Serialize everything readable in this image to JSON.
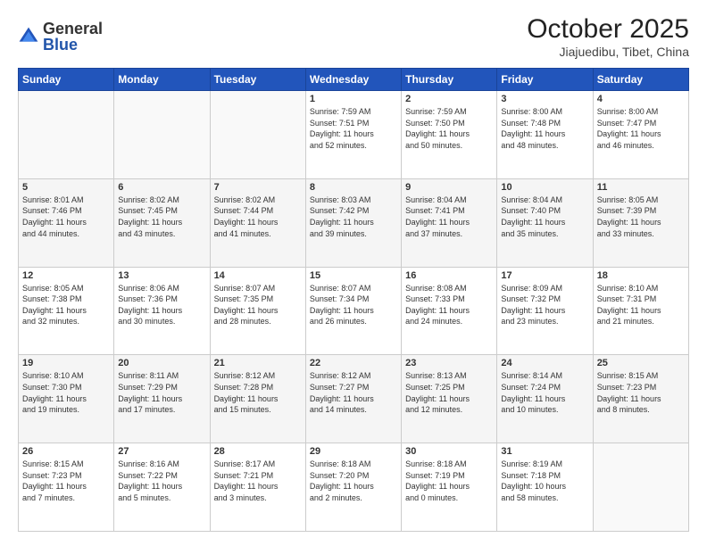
{
  "header": {
    "logo_general": "General",
    "logo_blue": "Blue",
    "month": "October 2025",
    "location": "Jiajuedibu, Tibet, China"
  },
  "days_of_week": [
    "Sunday",
    "Monday",
    "Tuesday",
    "Wednesday",
    "Thursday",
    "Friday",
    "Saturday"
  ],
  "weeks": [
    [
      {
        "day": "",
        "info": ""
      },
      {
        "day": "",
        "info": ""
      },
      {
        "day": "",
        "info": ""
      },
      {
        "day": "1",
        "info": "Sunrise: 7:59 AM\nSunset: 7:51 PM\nDaylight: 11 hours\nand 52 minutes."
      },
      {
        "day": "2",
        "info": "Sunrise: 7:59 AM\nSunset: 7:50 PM\nDaylight: 11 hours\nand 50 minutes."
      },
      {
        "day": "3",
        "info": "Sunrise: 8:00 AM\nSunset: 7:48 PM\nDaylight: 11 hours\nand 48 minutes."
      },
      {
        "day": "4",
        "info": "Sunrise: 8:00 AM\nSunset: 7:47 PM\nDaylight: 11 hours\nand 46 minutes."
      }
    ],
    [
      {
        "day": "5",
        "info": "Sunrise: 8:01 AM\nSunset: 7:46 PM\nDaylight: 11 hours\nand 44 minutes."
      },
      {
        "day": "6",
        "info": "Sunrise: 8:02 AM\nSunset: 7:45 PM\nDaylight: 11 hours\nand 43 minutes."
      },
      {
        "day": "7",
        "info": "Sunrise: 8:02 AM\nSunset: 7:44 PM\nDaylight: 11 hours\nand 41 minutes."
      },
      {
        "day": "8",
        "info": "Sunrise: 8:03 AM\nSunset: 7:42 PM\nDaylight: 11 hours\nand 39 minutes."
      },
      {
        "day": "9",
        "info": "Sunrise: 8:04 AM\nSunset: 7:41 PM\nDaylight: 11 hours\nand 37 minutes."
      },
      {
        "day": "10",
        "info": "Sunrise: 8:04 AM\nSunset: 7:40 PM\nDaylight: 11 hours\nand 35 minutes."
      },
      {
        "day": "11",
        "info": "Sunrise: 8:05 AM\nSunset: 7:39 PM\nDaylight: 11 hours\nand 33 minutes."
      }
    ],
    [
      {
        "day": "12",
        "info": "Sunrise: 8:05 AM\nSunset: 7:38 PM\nDaylight: 11 hours\nand 32 minutes."
      },
      {
        "day": "13",
        "info": "Sunrise: 8:06 AM\nSunset: 7:36 PM\nDaylight: 11 hours\nand 30 minutes."
      },
      {
        "day": "14",
        "info": "Sunrise: 8:07 AM\nSunset: 7:35 PM\nDaylight: 11 hours\nand 28 minutes."
      },
      {
        "day": "15",
        "info": "Sunrise: 8:07 AM\nSunset: 7:34 PM\nDaylight: 11 hours\nand 26 minutes."
      },
      {
        "day": "16",
        "info": "Sunrise: 8:08 AM\nSunset: 7:33 PM\nDaylight: 11 hours\nand 24 minutes."
      },
      {
        "day": "17",
        "info": "Sunrise: 8:09 AM\nSunset: 7:32 PM\nDaylight: 11 hours\nand 23 minutes."
      },
      {
        "day": "18",
        "info": "Sunrise: 8:10 AM\nSunset: 7:31 PM\nDaylight: 11 hours\nand 21 minutes."
      }
    ],
    [
      {
        "day": "19",
        "info": "Sunrise: 8:10 AM\nSunset: 7:30 PM\nDaylight: 11 hours\nand 19 minutes."
      },
      {
        "day": "20",
        "info": "Sunrise: 8:11 AM\nSunset: 7:29 PM\nDaylight: 11 hours\nand 17 minutes."
      },
      {
        "day": "21",
        "info": "Sunrise: 8:12 AM\nSunset: 7:28 PM\nDaylight: 11 hours\nand 15 minutes."
      },
      {
        "day": "22",
        "info": "Sunrise: 8:12 AM\nSunset: 7:27 PM\nDaylight: 11 hours\nand 14 minutes."
      },
      {
        "day": "23",
        "info": "Sunrise: 8:13 AM\nSunset: 7:25 PM\nDaylight: 11 hours\nand 12 minutes."
      },
      {
        "day": "24",
        "info": "Sunrise: 8:14 AM\nSunset: 7:24 PM\nDaylight: 11 hours\nand 10 minutes."
      },
      {
        "day": "25",
        "info": "Sunrise: 8:15 AM\nSunset: 7:23 PM\nDaylight: 11 hours\nand 8 minutes."
      }
    ],
    [
      {
        "day": "26",
        "info": "Sunrise: 8:15 AM\nSunset: 7:23 PM\nDaylight: 11 hours\nand 7 minutes."
      },
      {
        "day": "27",
        "info": "Sunrise: 8:16 AM\nSunset: 7:22 PM\nDaylight: 11 hours\nand 5 minutes."
      },
      {
        "day": "28",
        "info": "Sunrise: 8:17 AM\nSunset: 7:21 PM\nDaylight: 11 hours\nand 3 minutes."
      },
      {
        "day": "29",
        "info": "Sunrise: 8:18 AM\nSunset: 7:20 PM\nDaylight: 11 hours\nand 2 minutes."
      },
      {
        "day": "30",
        "info": "Sunrise: 8:18 AM\nSunset: 7:19 PM\nDaylight: 11 hours\nand 0 minutes."
      },
      {
        "day": "31",
        "info": "Sunrise: 8:19 AM\nSunset: 7:18 PM\nDaylight: 10 hours\nand 58 minutes."
      },
      {
        "day": "",
        "info": ""
      }
    ]
  ]
}
